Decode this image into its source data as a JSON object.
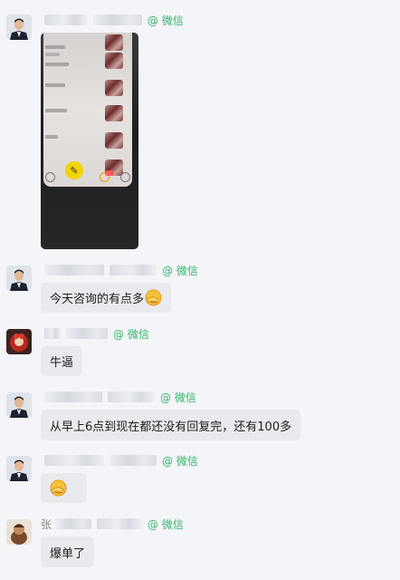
{
  "source_tag": "@ 微信",
  "messages": [
    {
      "id": "m1",
      "sender": "",
      "type": "image"
    },
    {
      "id": "m2",
      "sender": "",
      "text": "今天咨询的有点多",
      "emoji": "facepalm"
    },
    {
      "id": "m3",
      "sender": "",
      "text": "牛逼"
    },
    {
      "id": "m4",
      "sender": "",
      "text": "从早上6点到现在都还没有回复完，还有100多"
    },
    {
      "id": "m5",
      "sender": "",
      "emoji": "facepalm"
    },
    {
      "id": "m6",
      "sender": "张",
      "text": "爆单了"
    }
  ],
  "colors": {
    "page_bg": "#f4f5f8",
    "bubble_bg": "#e8eaee",
    "source_green": "#35b56b",
    "text": "#1d1d1d"
  },
  "icons": {
    "avatar_a": "man-in-suit-avatar",
    "avatar_b": "red-cartoon-avatar",
    "avatar_c": "character-figure-avatar",
    "emoji": "facepalm-emoji"
  }
}
